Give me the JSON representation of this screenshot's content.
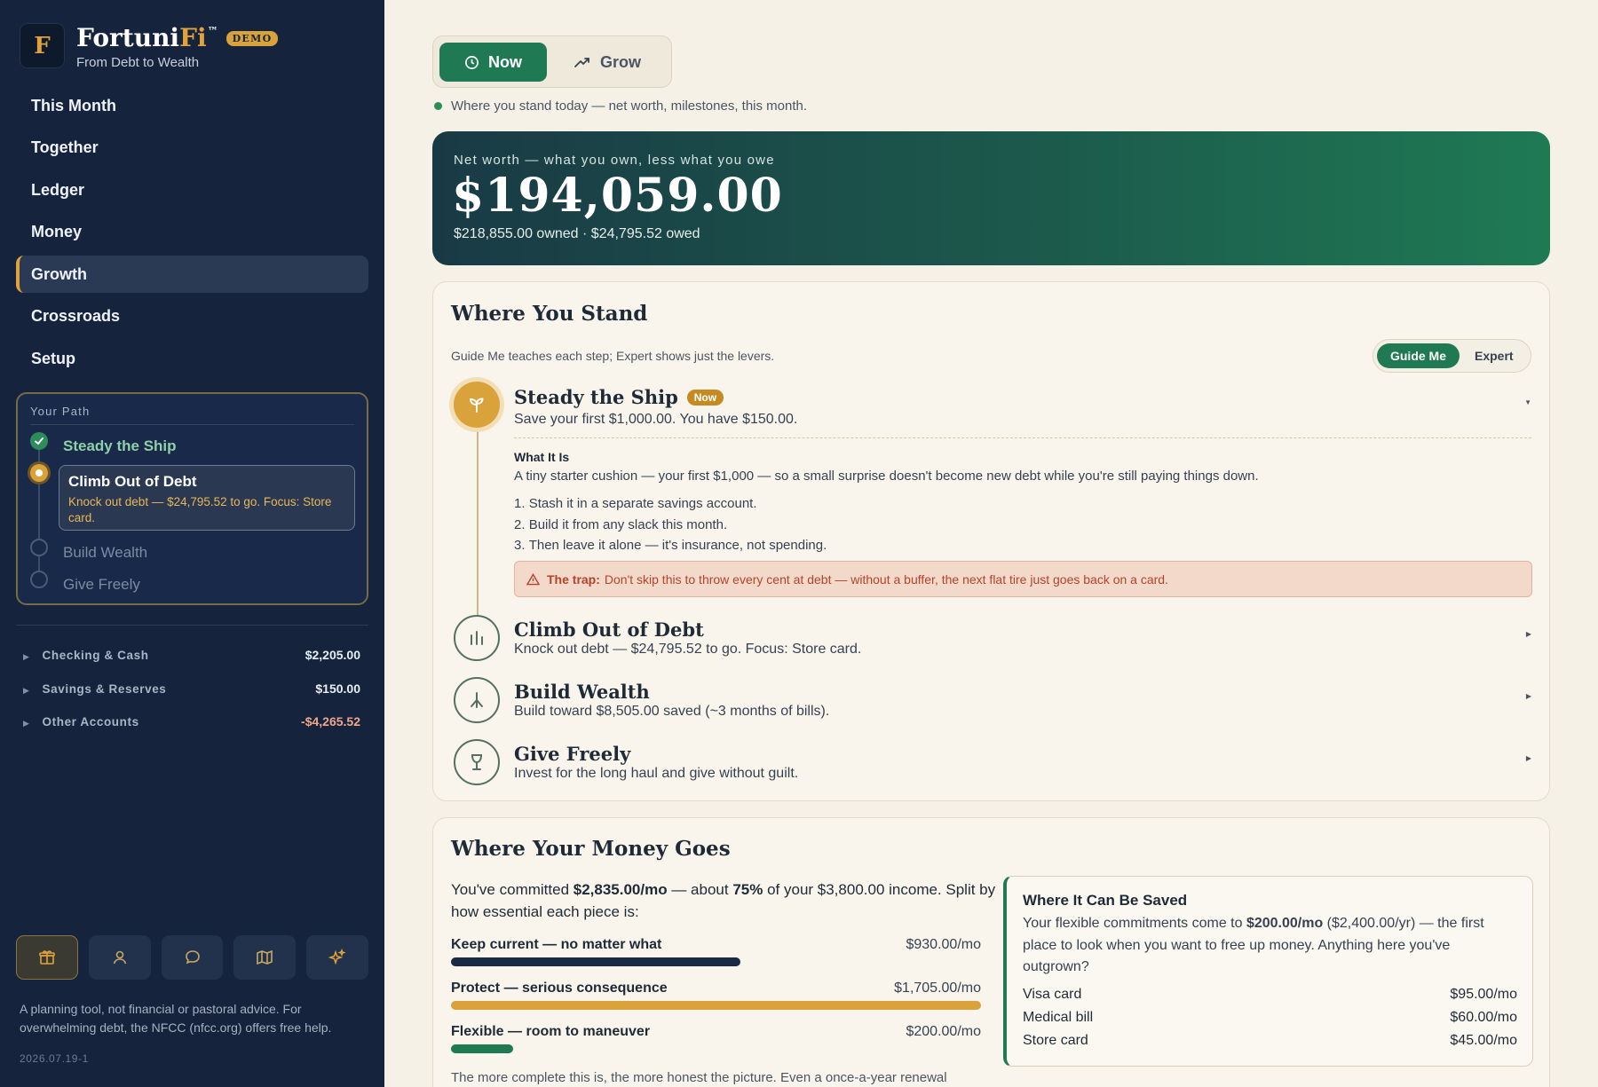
{
  "app": {
    "logo_letter": "F",
    "name_part1": "Fortuni",
    "name_part2": "Fi",
    "tm": "™",
    "badge": "DEMO",
    "tagline": "From Debt to Wealth"
  },
  "colors": {
    "sidebar_bg": "#15243c",
    "accent_gold": "#d9a23a",
    "accent_green": "#1f7a54",
    "page_bg": "#f6f1e6"
  },
  "nav": [
    {
      "label": "This Month",
      "active": false
    },
    {
      "label": "Together",
      "active": false
    },
    {
      "label": "Ledger",
      "active": false
    },
    {
      "label": "Money",
      "active": false
    },
    {
      "label": "Growth",
      "active": true
    },
    {
      "label": "Crossroads",
      "active": false
    },
    {
      "label": "Setup",
      "active": false
    }
  ],
  "path": {
    "title": "Your Path",
    "steps": [
      {
        "label": "Steady the Ship",
        "state": "done"
      },
      {
        "label": "Climb Out of Debt",
        "state": "current",
        "detail": "Knock out debt — $24,795.52 to go. Focus: Store card."
      },
      {
        "label": "Build Wealth",
        "state": "todo"
      },
      {
        "label": "Give Freely",
        "state": "todo"
      }
    ]
  },
  "accounts": [
    {
      "label": "Checking & Cash",
      "value": "$2,205.00"
    },
    {
      "label": "Savings & Reserves",
      "value": "$150.00"
    },
    {
      "label": "Other Accounts",
      "value": "-$4,265.52"
    }
  ],
  "toolbar_icons": [
    "gift-icon",
    "person-icon",
    "chat-icon",
    "map-icon",
    "sparkle-icon"
  ],
  "disclaimer": "A planning tool, not financial or pastoral advice. For overwhelming debt, the NFCC (nfcc.org) offers free help.",
  "version": "2026.07.19-1",
  "view_toggle": {
    "now": "Now",
    "grow": "Grow",
    "hint": "Where you stand today — net worth, milestones, this month."
  },
  "net_worth": {
    "label": "Net worth — what you own, less what you owe",
    "value": "$194,059.00",
    "detail": "$218,855.00 owned · $24,795.52 owed"
  },
  "where_you_stand": {
    "title": "Where You Stand",
    "desc": "Guide Me teaches each step; Expert shows just the levers.",
    "mode_guide": "Guide Me",
    "mode_expert": "Expert",
    "now_badge": "Now",
    "steps": [
      {
        "title": "Steady the Ship",
        "sub": "Save your first $1,000.00. You have $150.00.",
        "icon": "sprout-icon"
      },
      {
        "title": "Climb Out of Debt",
        "sub": "Knock out debt — $24,795.52 to go. Focus: Store card.",
        "icon": "bars-icon"
      },
      {
        "title": "Build Wealth",
        "sub": "Build toward $8,505.00 saved (~3 months of bills).",
        "icon": "branch-icon"
      },
      {
        "title": "Give Freely",
        "sub": "Invest for the long haul and give without guilt.",
        "icon": "goblet-icon"
      }
    ],
    "what_it_is": {
      "heading": "What It Is",
      "text": "A tiny starter cushion — your first $1,000 — so a small surprise doesn't become new debt while you're still paying things down.",
      "list": [
        "Stash it in a separate savings account.",
        "Build it from any slack this month.",
        "Then leave it alone — it's insurance, not spending."
      ],
      "trap_label": "The trap:",
      "trap_text": "Don't skip this to throw every cent at debt — without a buffer, the next flat tire just goes back on a card."
    }
  },
  "money_goes": {
    "title": "Where Your Money Goes",
    "intro_a": "You've committed ",
    "intro_committed": "$2,835.00/mo",
    "intro_b": " — about ",
    "intro_pct": "75%",
    "intro_c": " of your $3,800.00 income. Split by how essential each piece is:",
    "bars": [
      {
        "label": "Keep current — no matter what",
        "amount": "$930.00/mo",
        "value": 930,
        "color": "#1b2a44"
      },
      {
        "label": "Protect — serious consequence",
        "amount": "$1,705.00/mo",
        "value": 1705,
        "color": "#d9a23a"
      },
      {
        "label": "Flexible — room to maneuver",
        "amount": "$200.00/mo",
        "value": 200,
        "color": "#1f7a54"
      }
    ],
    "note": "The more complete this is, the more honest the picture. Even a once-a-year renewal",
    "saved": {
      "title": "Where It Can Be Saved",
      "desc_a": "Your flexible commitments come to ",
      "desc_amt": "$200.00/mo",
      "desc_b": " ($2,400.00/yr) — the first place to look when you want to free up money. Anything here you've outgrown?",
      "items": [
        {
          "label": "Visa card",
          "amount": "$95.00/mo"
        },
        {
          "label": "Medical bill",
          "amount": "$60.00/mo"
        },
        {
          "label": "Store card",
          "amount": "$45.00/mo"
        }
      ]
    }
  }
}
